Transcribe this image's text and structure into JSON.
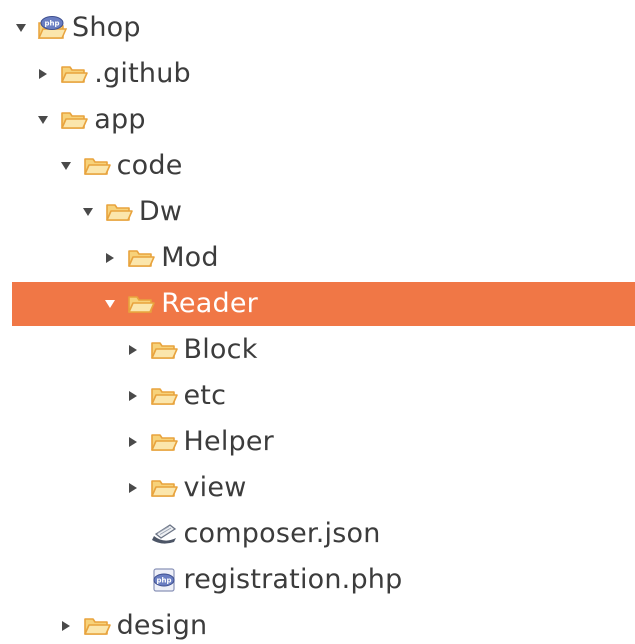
{
  "tree": {
    "items": [
      {
        "label": "Shop",
        "depth": 0,
        "expanded": true,
        "icon": "php-project-icon",
        "has_children": true,
        "selected": false
      },
      {
        "label": ".github",
        "depth": 1,
        "expanded": false,
        "icon": "folder-icon",
        "has_children": true,
        "selected": false
      },
      {
        "label": "app",
        "depth": 1,
        "expanded": true,
        "icon": "folder-icon",
        "has_children": true,
        "selected": false
      },
      {
        "label": "code",
        "depth": 2,
        "expanded": true,
        "icon": "folder-icon",
        "has_children": true,
        "selected": false
      },
      {
        "label": "Dw",
        "depth": 3,
        "expanded": true,
        "icon": "folder-icon",
        "has_children": true,
        "selected": false
      },
      {
        "label": "Mod",
        "depth": 4,
        "expanded": false,
        "icon": "folder-icon",
        "has_children": true,
        "selected": false
      },
      {
        "label": "Reader",
        "depth": 4,
        "expanded": true,
        "icon": "folder-icon",
        "has_children": true,
        "selected": true
      },
      {
        "label": "Block",
        "depth": 5,
        "expanded": false,
        "icon": "folder-icon",
        "has_children": true,
        "selected": false
      },
      {
        "label": "etc",
        "depth": 5,
        "expanded": false,
        "icon": "folder-icon",
        "has_children": true,
        "selected": false
      },
      {
        "label": "Helper",
        "depth": 5,
        "expanded": false,
        "icon": "folder-icon",
        "has_children": true,
        "selected": false
      },
      {
        "label": "view",
        "depth": 5,
        "expanded": false,
        "icon": "folder-icon",
        "has_children": true,
        "selected": false
      },
      {
        "label": "composer.json",
        "depth": 5,
        "expanded": false,
        "icon": "json-file-icon",
        "has_children": false,
        "selected": false
      },
      {
        "label": "registration.php",
        "depth": 5,
        "expanded": false,
        "icon": "php-file-icon",
        "has_children": false,
        "selected": false
      },
      {
        "label": "design",
        "depth": 2,
        "expanded": false,
        "icon": "folder-icon",
        "has_children": true,
        "selected": false
      }
    ]
  },
  "colors": {
    "selection": "#f07746",
    "folder": "#e8a33d",
    "text": "#3c3c3c",
    "text_selected": "#ffffff",
    "php": "#6a7ec2"
  }
}
